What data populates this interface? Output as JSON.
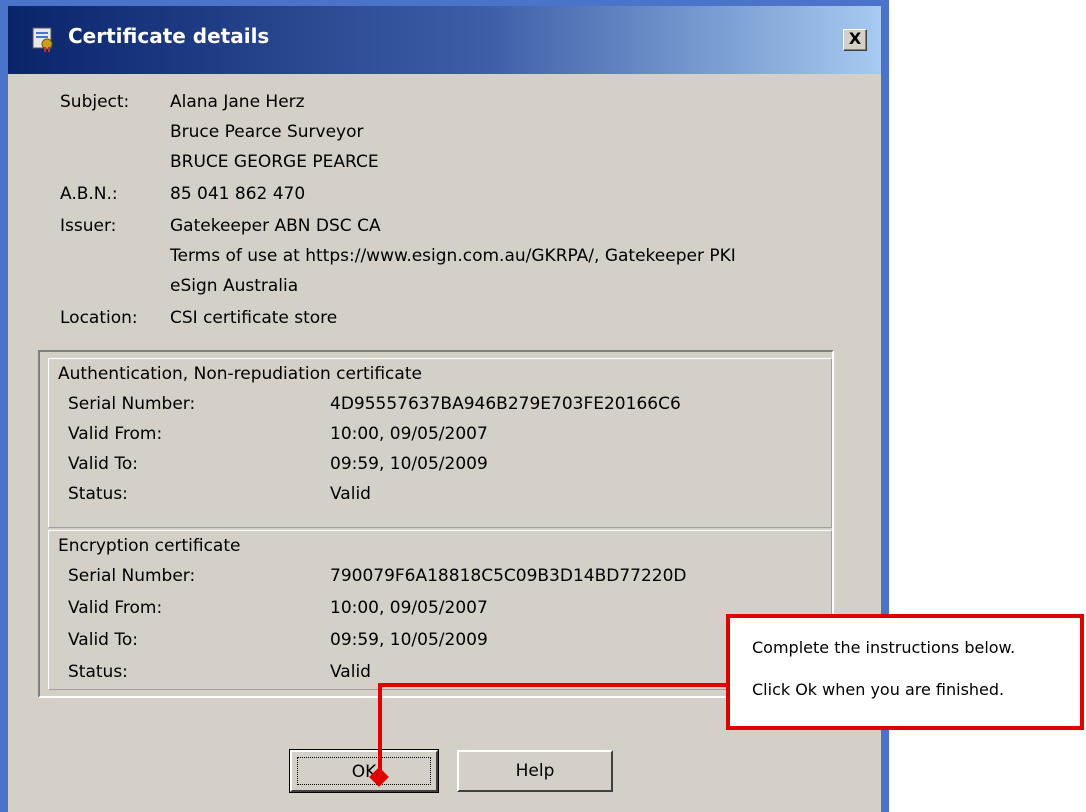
{
  "window": {
    "title": "Certificate details",
    "icon": "certificate-icon",
    "close_label": "X"
  },
  "fields": [
    {
      "label": "Subject:",
      "values": [
        "Alana Jane Herz",
        "Bruce Pearce Surveyor",
        "BRUCE GEORGE PEARCE"
      ]
    },
    {
      "label": "A.B.N.:",
      "values": [
        "85 041 862 470"
      ]
    },
    {
      "label": "Issuer:",
      "values": [
        "Gatekeeper ABN DSC CA",
        "Terms of use at https://www.esign.com.au/GKRPA/, Gatekeeper PKI",
        "eSign Australia"
      ]
    },
    {
      "label": "Location:",
      "values": [
        "CSI certificate store"
      ]
    }
  ],
  "certificates": [
    {
      "title": "Authentication, Non-repudiation certificate",
      "rows": [
        {
          "label": "Serial Number:",
          "value": "4D95557637BA946B279E703FE20166C6"
        },
        {
          "label": "Valid From:",
          "value": "10:00, 09/05/2007"
        },
        {
          "label": "Valid To:",
          "value": "09:59, 10/05/2009"
        },
        {
          "label": "Status:",
          "value": "Valid"
        }
      ]
    },
    {
      "title": "Encryption certificate",
      "rows": [
        {
          "label": "Serial Number:",
          "value": "790079F6A18818C5C09B3D14BD77220D"
        },
        {
          "label": "Valid From:",
          "value": "10:00, 09/05/2007"
        },
        {
          "label": "Valid To:",
          "value": "09:59, 10/05/2009"
        },
        {
          "label": "Status:",
          "value": "Valid"
        }
      ]
    }
  ],
  "buttons": {
    "ok": "OK",
    "help": "Help"
  },
  "callout": {
    "line1": "Complete the instructions below.",
    "line2": "Click Ok when you are finished.",
    "color": "#e00000"
  }
}
